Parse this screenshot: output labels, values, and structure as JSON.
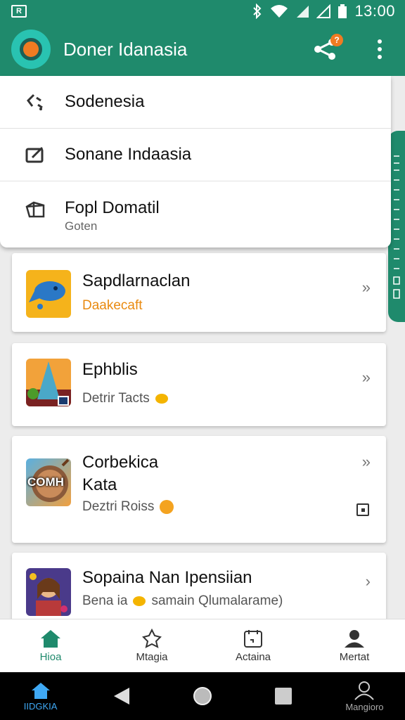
{
  "status_bar": {
    "time": "13:00"
  },
  "app_bar": {
    "title": "Doner Idanasia",
    "share_badge": "?"
  },
  "menu": {
    "items": [
      {
        "label": "Sodenesia",
        "icon": "link-icon"
      },
      {
        "label": "Sonane Indaasia",
        "icon": "edit-icon"
      },
      {
        "label": "Fopl Domatil",
        "sub": "Goten",
        "icon": "box-icon"
      }
    ]
  },
  "cards": [
    {
      "title": "Sapdlarnaclan",
      "sub": "Daakecaft",
      "icon": "fish-app-icon"
    },
    {
      "title": "Ephblis",
      "sub": "Detrir Tacts",
      "icon": "cone-app-icon"
    },
    {
      "title": "Corbekica",
      "title2": "Kata",
      "sub": "Deztri Roiss",
      "icon": "coin-app-icon",
      "icon_text": "COMH"
    },
    {
      "title": "Sopaina Nan Ipensiian",
      "sub_prefix": "Bena ia",
      "sub": "samain Qlumalarame)",
      "icon": "character-app-icon"
    }
  ],
  "bottom_nav": [
    {
      "label": "Hioa",
      "icon": "home-icon",
      "active": true
    },
    {
      "label": "Mtagia",
      "icon": "explore-icon"
    },
    {
      "label": "Actaina",
      "icon": "calendar-icon"
    },
    {
      "label": "Mertat",
      "icon": "profile-icon"
    }
  ],
  "system_nav": [
    {
      "label": "IIDGKIA",
      "icon": "home-icon",
      "active": true
    },
    {
      "label": "",
      "icon": "back-icon"
    },
    {
      "label": "",
      "icon": "circle-home-icon"
    },
    {
      "label": "",
      "icon": "recents-icon"
    },
    {
      "label": "Mangioro",
      "icon": "person-icon"
    }
  ],
  "colors": {
    "primary": "#1f8a6c",
    "accent": "#f07b22"
  }
}
